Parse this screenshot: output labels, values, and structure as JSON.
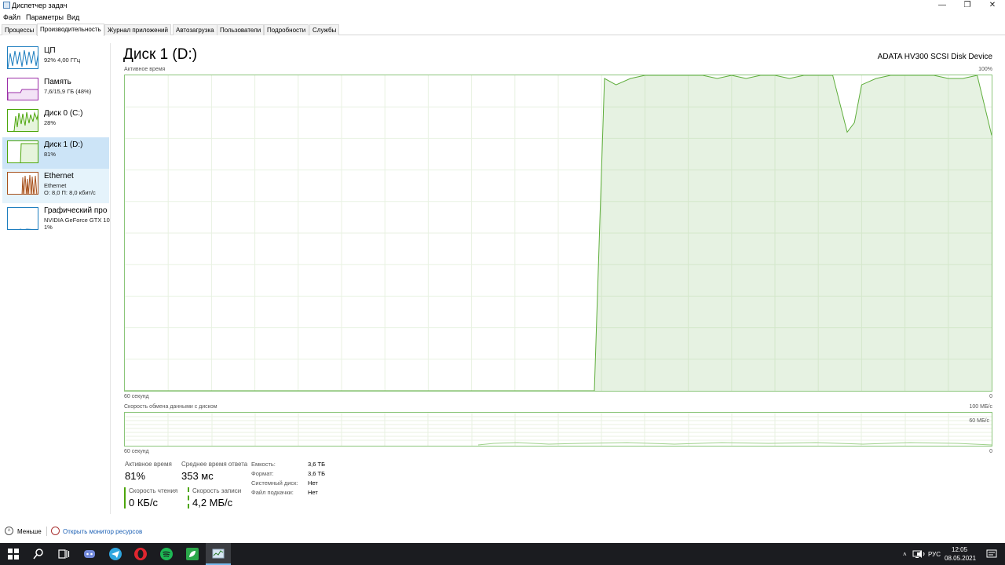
{
  "window": {
    "title": "Диспетчер задач",
    "controls": {
      "minimize": "—",
      "restore": "❐",
      "close": "✕"
    }
  },
  "menu": [
    "Файл",
    "Параметры",
    "Вид"
  ],
  "tabs": [
    "Процессы",
    "Производительность",
    "Журнал приложений",
    "Автозагрузка",
    "Пользователи",
    "Подробности",
    "Службы"
  ],
  "sidebar": {
    "items": [
      {
        "name": "ЦП",
        "sub1": "92% 4,00 ГГц",
        "sub2": ""
      },
      {
        "name": "Память",
        "sub1": "7,6/15,9 ГБ (48%)",
        "sub2": ""
      },
      {
        "name": "Диск 0 (C:)",
        "sub1": "28%",
        "sub2": ""
      },
      {
        "name": "Диск 1 (D:)",
        "sub1": "81%",
        "sub2": ""
      },
      {
        "name": "Ethernet",
        "sub1": "Ethernet",
        "sub2": "О: 8,0 П: 8,0 кбит/с"
      },
      {
        "name": "Графический про",
        "sub1": "NVIDIA GeForce GTX 10(",
        "sub2": "1%"
      }
    ]
  },
  "main": {
    "title": "Диск 1 (D:)",
    "device": "ADATA HV300 SCSI Disk Device",
    "graph1": {
      "label": "Активное время",
      "max_label": "100%",
      "time_label": "60 секунд",
      "min_label": "0"
    },
    "graph2": {
      "label": "Скорость обмена данными с диском",
      "max_label": "100 МБ/с",
      "mid_label": "60 МБ/с",
      "time_label": "60 секунд",
      "min_label": "0"
    },
    "stats": {
      "active_label": "Активное время",
      "active_value": "81%",
      "response_label": "Среднее время ответа",
      "response_value": "353 мс",
      "read_label": "Скорость чтения",
      "read_value": "0 КБ/с",
      "write_label": "Скорость записи",
      "write_value": "4,2 МБ/с"
    },
    "info": [
      {
        "label": "Емкость:",
        "value": "3,6 ТБ"
      },
      {
        "label": "Формат:",
        "value": "3,6 ТБ"
      },
      {
        "label": "Системный диск:",
        "value": "Нет"
      },
      {
        "label": "Файл подкачки:",
        "value": "Нет"
      }
    ]
  },
  "footer": {
    "less": "Меньше",
    "monitor": "Открыть монитор ресурсов"
  },
  "taskbar": {
    "lang": "РУС",
    "time": "12:05",
    "date": "08.05.2021"
  },
  "chart_data": {
    "type": "area",
    "title": "Активное время",
    "x": [
      60,
      58,
      56,
      54,
      52,
      50,
      48,
      46,
      44,
      42,
      40,
      38,
      36,
      34,
      32,
      30,
      28,
      27.5,
      26.8,
      26,
      25,
      24,
      23,
      22,
      21,
      20,
      19,
      18,
      17,
      16,
      15,
      14,
      13,
      12,
      11,
      10,
      9.5,
      9,
      8,
      7,
      6,
      5,
      4,
      3,
      2,
      1,
      0
    ],
    "values": [
      0,
      0,
      0,
      0,
      0,
      0,
      0,
      0,
      0,
      0,
      0,
      0,
      0,
      0,
      0,
      0,
      0,
      0,
      99,
      97,
      99,
      100,
      100,
      100,
      100,
      100,
      99,
      100,
      99,
      100,
      100,
      99,
      100,
      100,
      100,
      82,
      85,
      97,
      99,
      100,
      100,
      100,
      100,
      99,
      99,
      100,
      81
    ],
    "xlim": [
      60,
      0
    ],
    "ylim": [
      0,
      100
    ],
    "grid": true
  }
}
